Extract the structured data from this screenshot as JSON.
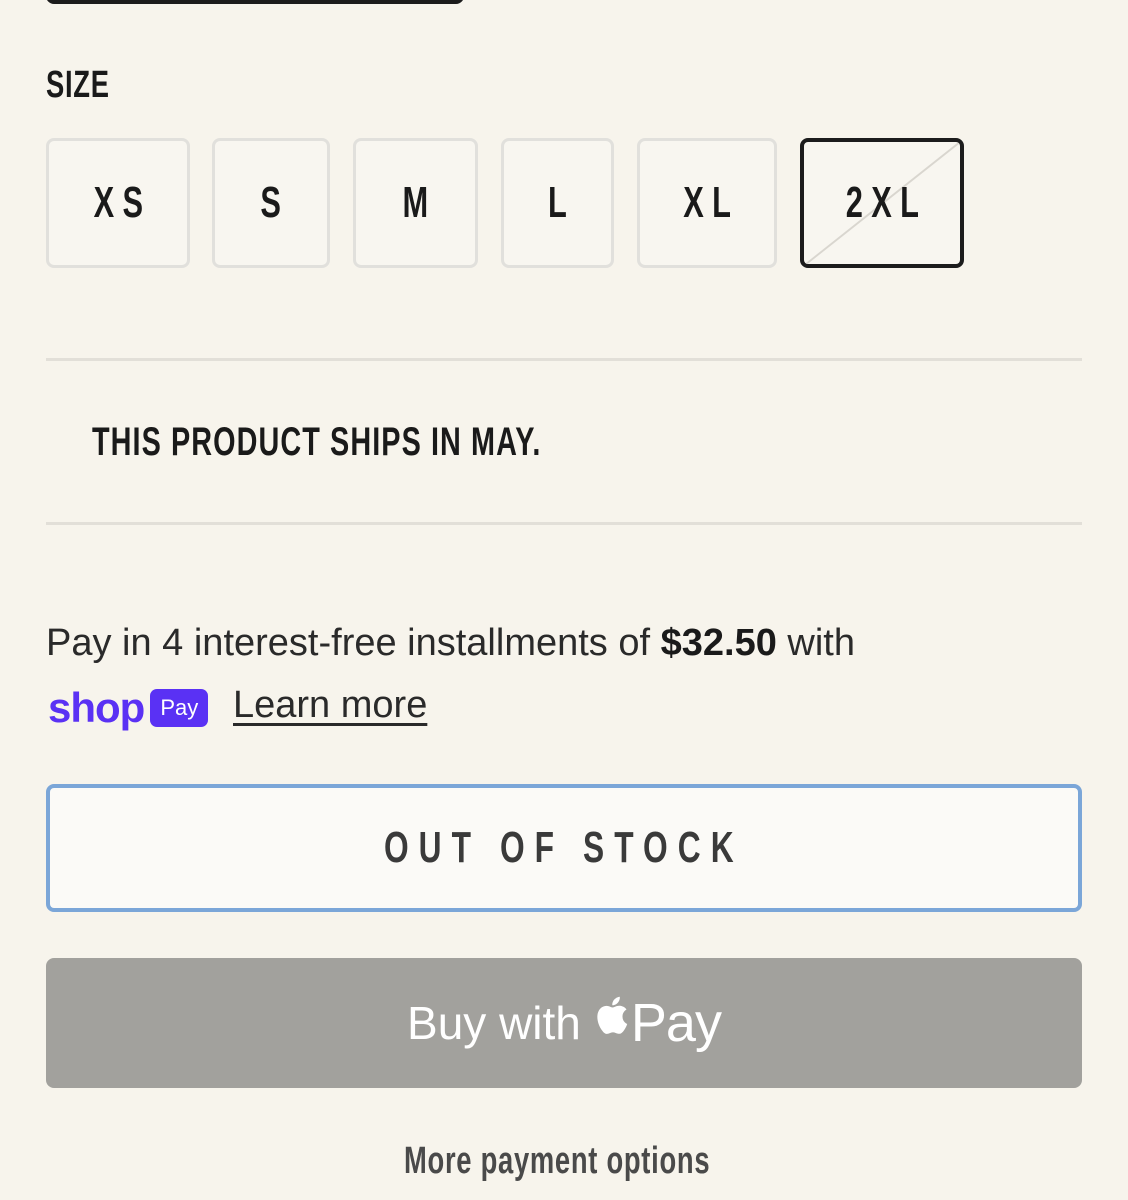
{
  "size": {
    "label": "SIZE",
    "options": [
      "XS",
      "S",
      "M",
      "L",
      "XL",
      "2XL"
    ],
    "selected": "2XL"
  },
  "notice": "THIS PRODUCT SHIPS IN MAY.",
  "installments": {
    "prefix": "Pay in 4 interest-free installments of",
    "amount": "$32.50",
    "suffix": "with",
    "shop_word": "shop",
    "pay_pill": "Pay",
    "learn_more": "Learn more"
  },
  "buttons": {
    "out_of_stock": "OUT OF STOCK",
    "apple_pay_prefix": "Buy with",
    "apple_pay_word": "Pay",
    "more_options": "More payment options"
  },
  "colors": {
    "background": "#f7f4ec",
    "shop_pay_purple": "#5a31f4",
    "focus_blue": "#7ba6d8",
    "apple_pay_gray": "#a2a19d"
  },
  "icons": {
    "apple_logo": "apple-icon"
  }
}
